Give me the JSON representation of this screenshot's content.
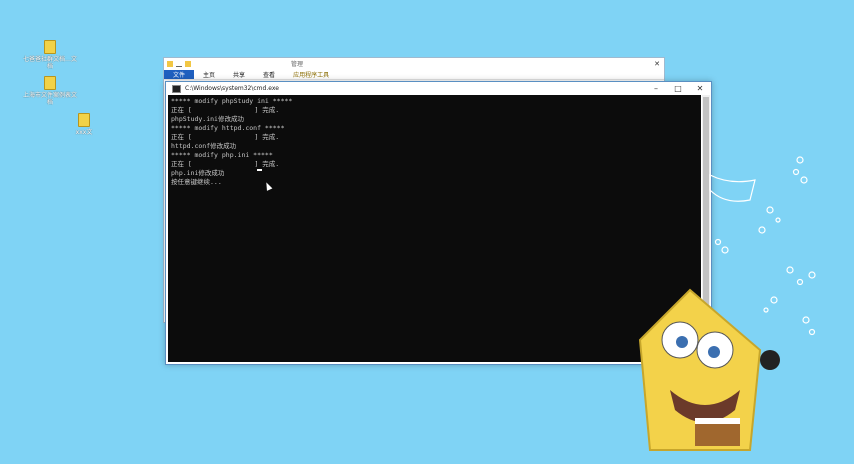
{
  "desktop": {
    "icons": [
      {
        "name": "file-icon-1",
        "label": "七爸爸社群文档…文档"
      },
      {
        "name": "file-icon-2",
        "label": "上海市文件案例表文档"
      },
      {
        "name": "file-icon-3",
        "label": "xxx文"
      }
    ]
  },
  "explorer": {
    "title": "管理",
    "tabs": [
      {
        "label": "文件",
        "active": true
      },
      {
        "label": "主页",
        "active": false
      },
      {
        "label": "共享",
        "active": false
      },
      {
        "label": "查看",
        "active": false
      },
      {
        "label": "应用程序工具",
        "active": false
      }
    ]
  },
  "cmd": {
    "title": "C:\\Windows\\system32\\cmd.exe",
    "lines": [
      "***** modify phpStudy ini *****",
      "正在 [                ] 完成.",
      "phpStudy.ini修改成功",
      "***** modify httpd.conf *****",
      "正在 [                ] 完成.",
      "httpd.conf修改成功",
      "***** modify php.ini *****",
      "正在 [                ] 完成.",
      "php.ini修改成功",
      "按任意键继续..."
    ]
  },
  "colors": {
    "wallpaper": "#7fd3f5",
    "console_bg": "#0c0c0c",
    "console_fg": "#c8c8c8",
    "ribbon_active": "#1f5fbf"
  }
}
